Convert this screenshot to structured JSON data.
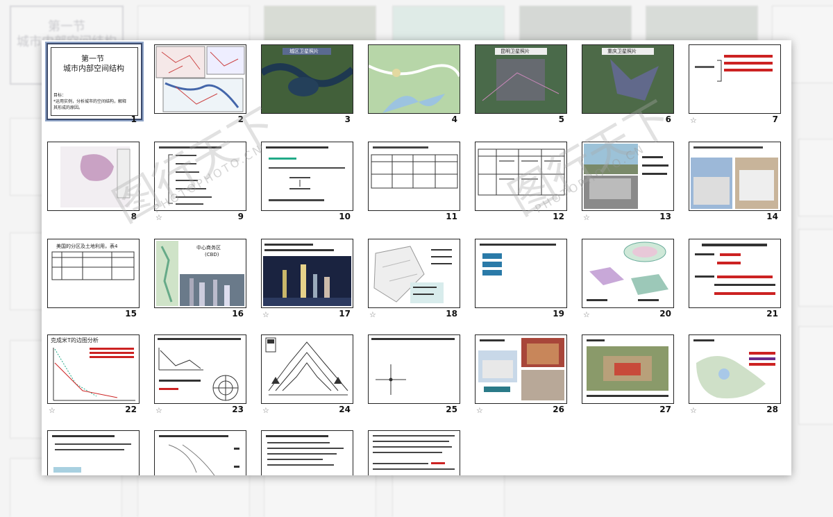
{
  "title_slide": {
    "line1": "第一节",
    "line2": "城市内部空间结构",
    "body1": "目标：",
    "body2": "*运用实例，分析城市的空间结构，解释",
    "body3": "其形成的原因。"
  },
  "slide_titles": {
    "s3": "城区卫星照片",
    "s5": "昆明卫星照片",
    "s6": "重庆卫星照片",
    "s15": "美国的分区及土地利用，表4",
    "s16_a": "中心商务区",
    "s16_b": "(CBD)",
    "s22": "克成米T的边图分析"
  },
  "slide_numbers": [
    "1",
    "2",
    "3",
    "4",
    "5",
    "6",
    "7",
    "8",
    "9",
    "10",
    "11",
    "12",
    "13",
    "14",
    "15",
    "16",
    "17",
    "18",
    "19",
    "20",
    "21",
    "22",
    "23",
    "24",
    "25",
    "26",
    "27",
    "28"
  ],
  "star_glyph": "☆",
  "watermarks": {
    "cn": "图行天下",
    "en": "PHOTOPHOTO.CN"
  },
  "colors": {
    "selected_border": "#3b4a6b",
    "accent_red": "#c11111"
  }
}
